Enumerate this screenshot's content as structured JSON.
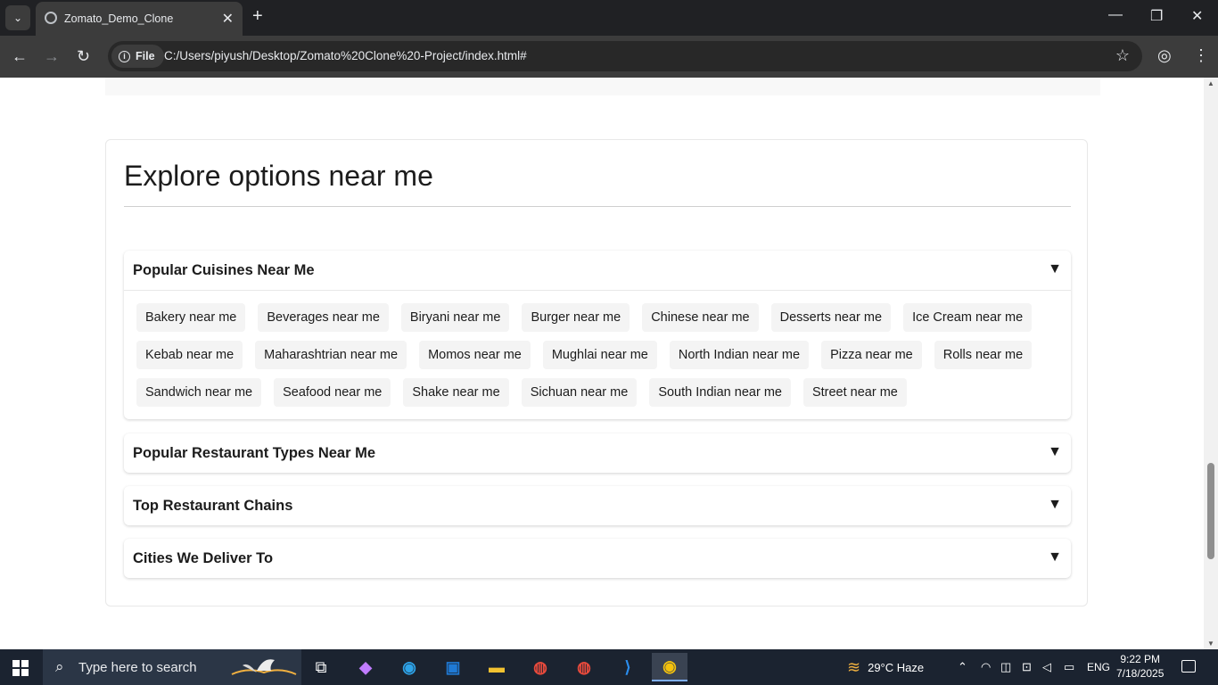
{
  "browser": {
    "tab_title": "Zomato_Demo_Clone",
    "scheme_label": "File",
    "url": "C:/Users/piyush/Desktop/Zomato%20Clone%20-Project/index.html#"
  },
  "page": {
    "explore_title": "Explore options near me",
    "sections": [
      {
        "title": "Popular Cuisines Near Me",
        "expanded": true,
        "items": [
          "Bakery near me",
          "Beverages near me",
          "Biryani near me",
          "Burger near me",
          "Chinese near me",
          "Desserts near me",
          "Ice Cream near me",
          "Kebab near me",
          "Maharashtrian near me",
          "Momos near me",
          "Mughlai near me",
          "North Indian near me",
          "Pizza near me",
          "Rolls near me",
          "Sandwich near me",
          "Seafood near me",
          "Shake near me",
          "Sichuan near me",
          "South Indian near me",
          "Street near me"
        ]
      },
      {
        "title": "Popular Restaurant Types Near Me",
        "expanded": false
      },
      {
        "title": "Top Restaurant Chains",
        "expanded": false
      },
      {
        "title": "Cities We Deliver To",
        "expanded": false
      }
    ],
    "arrow": "▼"
  },
  "taskbar": {
    "search_placeholder": "Type here to search",
    "weather": "29°C  Haze",
    "language": "ENG",
    "time": "9:22 PM",
    "date": "7/18/2025"
  },
  "colors": {
    "text": "#1c1c1c",
    "chip_bg": "#f4f4f4",
    "tabbar": "#202124",
    "toolbar": "#3c3c3c"
  }
}
